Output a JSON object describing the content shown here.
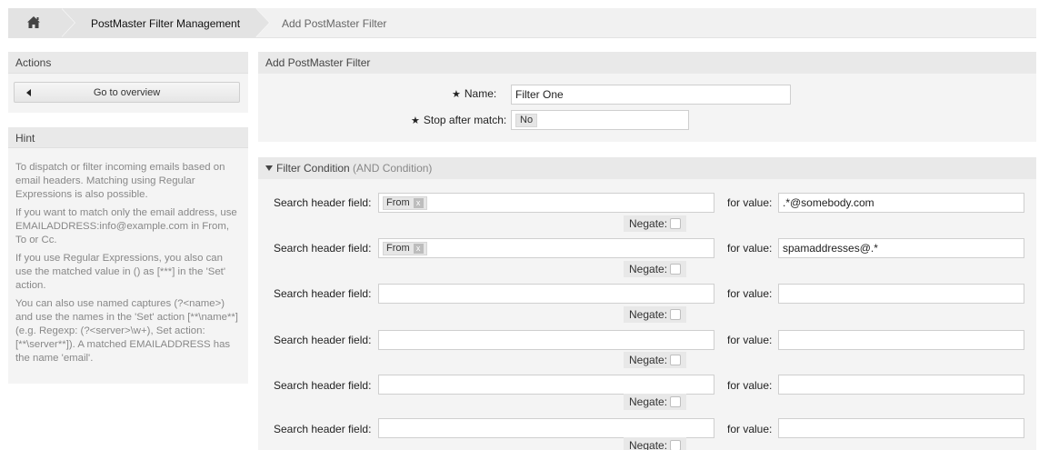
{
  "breadcrumb": {
    "home_icon": "home-icon",
    "items": [
      "PostMaster Filter Management",
      "Add PostMaster Filter"
    ]
  },
  "sidebar": {
    "actions_title": "Actions",
    "overview_button": "Go to overview",
    "hint_title": "Hint",
    "hint_paragraphs": [
      "To dispatch or filter incoming emails based on email headers. Matching using Regular Expressions is also possible.",
      "If you want to match only the email address, use EMAILADDRESS:info@example.com in From, To or Cc.",
      "If you use Regular Expressions, you also can use the matched value in () as [***] in the 'Set' action.",
      "You can also use named captures (?<name>) and use the names in the 'Set' action [**\\name**] (e.g. Regexp: (?<server>\\w+), Set action: [**\\server**]). A matched EMAILADDRESS has the name 'email'."
    ]
  },
  "main": {
    "title": "Add PostMaster Filter",
    "name_label": "Name:",
    "name_value": "Filter One",
    "stop_label": "Stop after match:",
    "stop_value": "No",
    "required_mark": "★"
  },
  "conditions": {
    "title": "Filter Condition",
    "subtitle": "(AND Condition)",
    "search_label": "Search header field:",
    "value_label": "for value:",
    "negate_label": "Negate:",
    "remove_tag": "x",
    "rows": [
      {
        "header": "From",
        "value": ".*@somebody.com"
      },
      {
        "header": "From",
        "value": "spamaddresses@.*"
      },
      {
        "header": "",
        "value": ""
      },
      {
        "header": "",
        "value": ""
      },
      {
        "header": "",
        "value": ""
      },
      {
        "header": "",
        "value": ""
      }
    ]
  },
  "colors": {
    "panel": "#f4f4f4",
    "header": "#e9e9e9",
    "breadcrumb_active": "#e3e3e3"
  }
}
